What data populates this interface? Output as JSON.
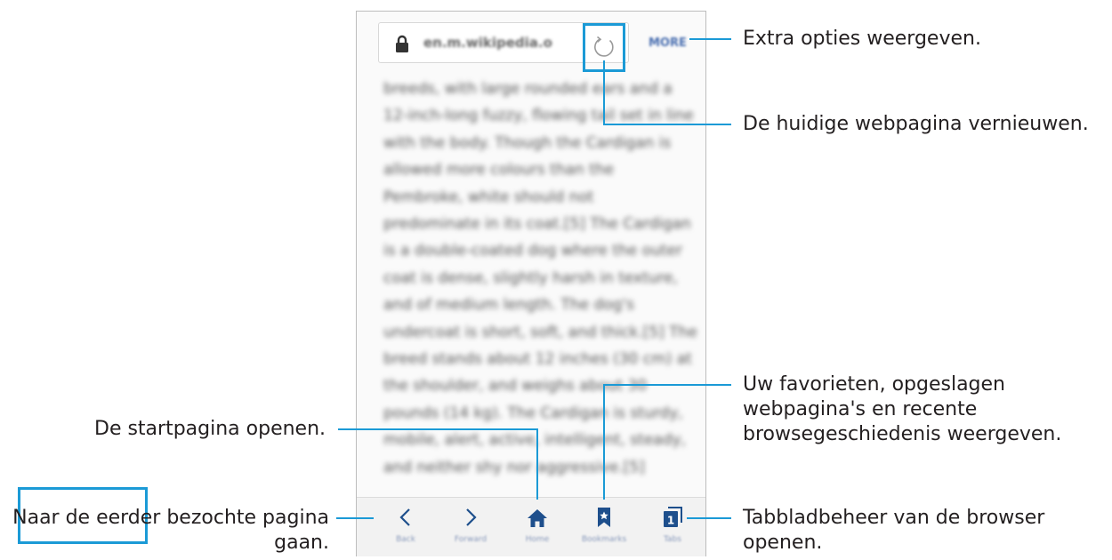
{
  "browser": {
    "url": "en.m.wikipedia.o",
    "more_label": "MORE"
  },
  "page_lines": [
    "breeds, with large rounded ears and a",
    "12-inch-long fuzzy, flowing tail set in line",
    "with the body. Though the Cardigan is",
    "allowed more colours than the",
    "Pembroke, white should not",
    "predominate in its coat.[5] The Cardigan",
    "is a double-coated dog where the outer",
    "coat is dense, slightly harsh in texture,",
    "and of medium length. The dog's",
    "undercoat is short, soft, and thick.[5] The",
    "breed stands about 12 inches (30 cm) at",
    "the shoulder, and weighs about 30",
    "pounds (14 kg). The Cardigan is sturdy,",
    "mobile, alert, active, intelligent, steady,",
    "and neither shy nor aggressive.[5]"
  ],
  "nav": {
    "back": "Back",
    "forward": "Forward",
    "home": "Home",
    "bookmarks": "Bookmarks",
    "tabs": "Tabs",
    "tab_count": "1"
  },
  "callouts": {
    "more": "Extra opties weergeven.",
    "refresh": "De huidige webpagina vernieuwen.",
    "bookmarks_line1": "Uw favorieten, opgeslagen",
    "bookmarks_line2": "webpagina's en recente",
    "bookmarks_line3": "browsegeschiedenis weergeven.",
    "home": "De startpagina openen.",
    "backfwd_line1": "Naar de eerder bezochte pagina",
    "backfwd_line2": "gaan.",
    "tabs_line1": "Tabbladbeheer van de browser",
    "tabs_line2": "openen."
  },
  "colors": {
    "accent": "#1b9ad6",
    "icon": "#1e4f8c"
  }
}
